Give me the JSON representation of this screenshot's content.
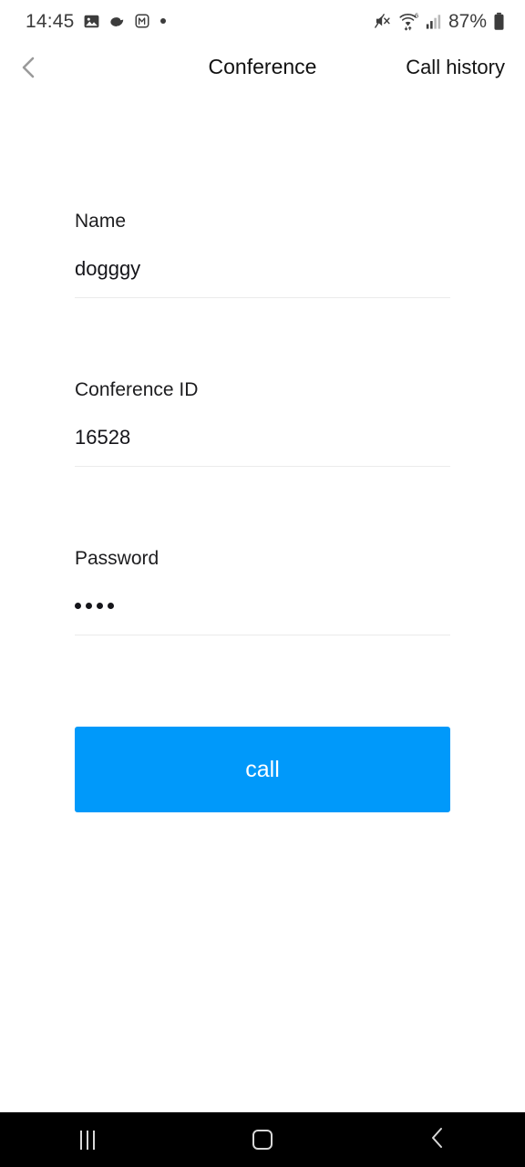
{
  "status_bar": {
    "time": "14:45",
    "left_icons": [
      "photos-icon",
      "shell-icon",
      "messenger-m-icon",
      "dot-indicator-icon"
    ],
    "right_icons": [
      "mute-icon",
      "wifi-6-icon",
      "cellular-signal-icon",
      "battery-icon"
    ],
    "wifi_generation": "6",
    "battery_percent": "87%"
  },
  "header": {
    "back_icon": "back-chevron-icon",
    "title": "Conference",
    "action_label": "Call history"
  },
  "form": {
    "fields": [
      {
        "label": "Name",
        "value": "dogggy",
        "placeholder": "Name",
        "type": "text"
      },
      {
        "label": "Conference ID",
        "value": "16528",
        "placeholder": "Conference ID",
        "type": "text"
      },
      {
        "label": "Password",
        "value": "••••",
        "masked_char_count": 4,
        "placeholder": "Password",
        "type": "password"
      }
    ]
  },
  "call_button": {
    "label": "call",
    "color": "#0099fa",
    "text_color": "#ffffff"
  },
  "nav_bar": {
    "background": "#000000",
    "items": [
      {
        "name": "recents",
        "icon": "recents-icon"
      },
      {
        "name": "home",
        "icon": "home-icon"
      },
      {
        "name": "back",
        "icon": "back-icon"
      }
    ]
  },
  "colors": {
    "accent": "#0099fa",
    "page_background": "#ffffff",
    "text_primary": "#15151a",
    "underline": "#ebebeb",
    "nav_glyph": "#d8d8d8"
  }
}
